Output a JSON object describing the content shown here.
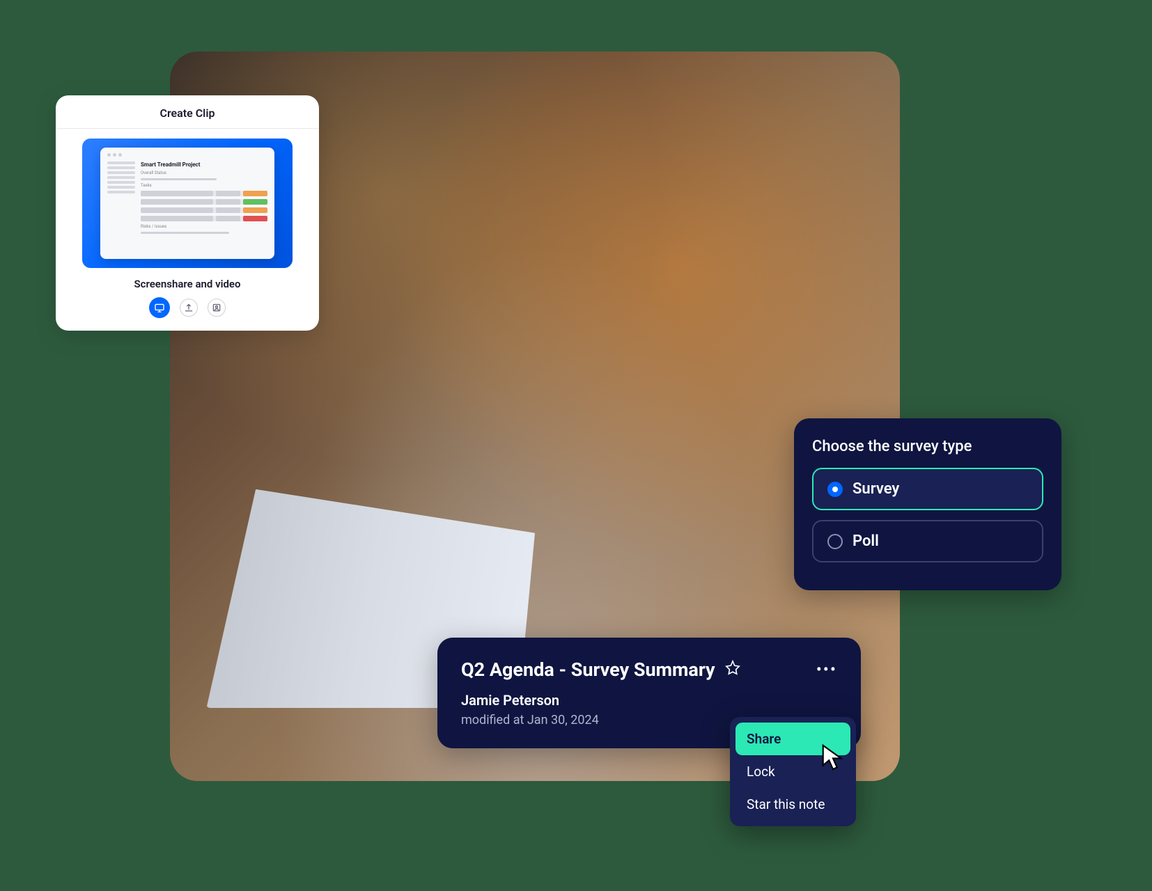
{
  "clip": {
    "title": "Create Clip",
    "preview_doc_title": "Smart Treadmill Project",
    "preview_section1": "Overall Status",
    "preview_section2": "Tasks",
    "preview_section3": "Risks / Issues",
    "footer_label": "Screenshare and video"
  },
  "survey": {
    "title": "Choose the survey type",
    "options": [
      {
        "label": "Survey",
        "selected": true
      },
      {
        "label": "Poll",
        "selected": false
      }
    ]
  },
  "agenda": {
    "title": "Q2 Agenda - Survey Summary",
    "author": "Jamie Peterson",
    "modified": "modified at Jan 30, 2024"
  },
  "context_menu": {
    "items": [
      {
        "label": "Share",
        "active": true
      },
      {
        "label": "Lock",
        "active": false
      },
      {
        "label": "Star this note",
        "active": false
      }
    ]
  },
  "colors": {
    "bg": "#2d5a3d",
    "panel_dark": "#0f1540",
    "panel_inner": "#1a2155",
    "accent_green": "#2ce8b5",
    "accent_blue": "#0066ff"
  }
}
